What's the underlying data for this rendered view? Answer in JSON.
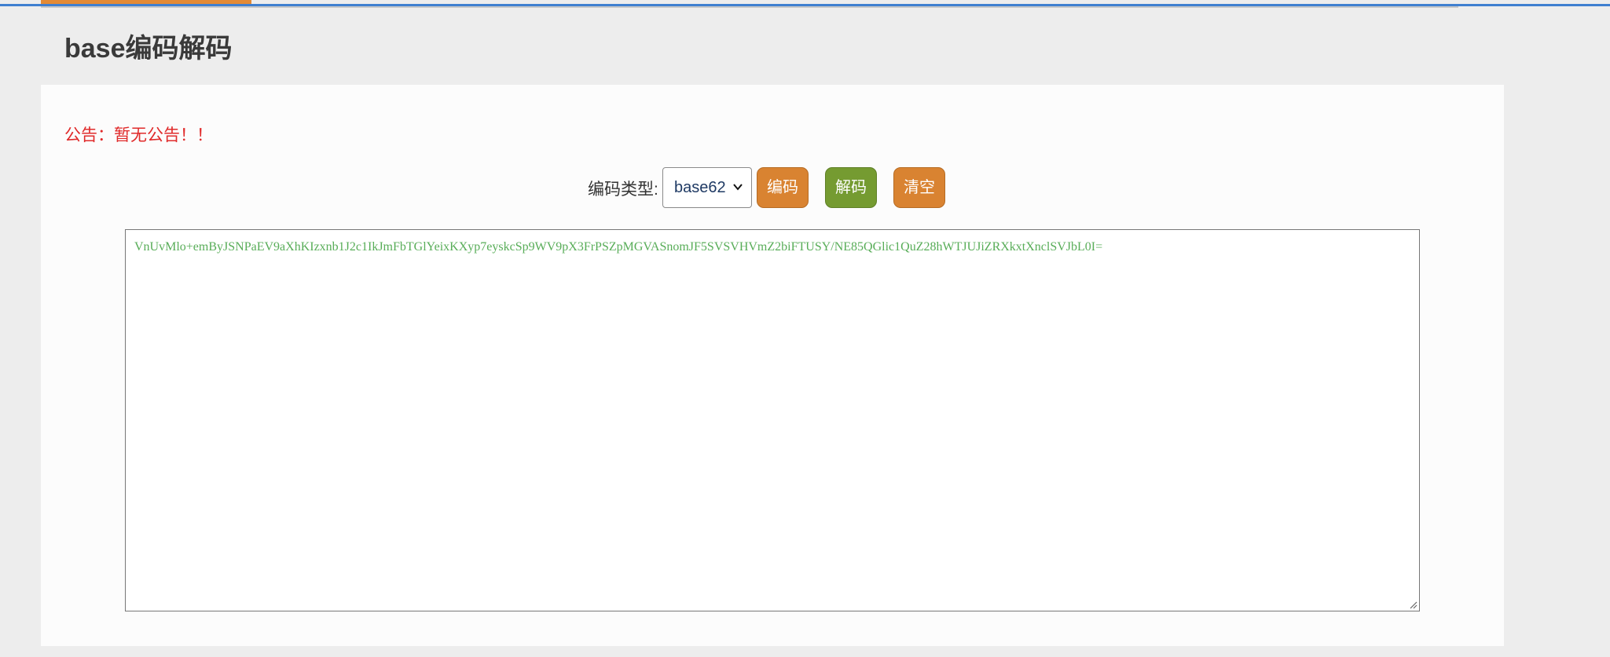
{
  "page": {
    "title": "base编码解码",
    "notice": "公告：暂无公告！！"
  },
  "controls": {
    "type_label": "编码类型:",
    "type_select": {
      "selected": "base62"
    },
    "encode_label": "编码",
    "decode_label": "解码",
    "clear_label": "清空"
  },
  "editor": {
    "content": "VnUvMlo+emByJSNPaEV9aXhKIzxnb1J2c1IkJmFbTGlYeixKXyp7eyskcSp9WV9pX3FrPSZpMGVASnomJF5SVSVHVmZ2biFTUSY/NE85QGlic1QuZ28hWTJUJiZRXkxtXnclSVJbL0I="
  },
  "colors": {
    "accent_orange": "#d98331",
    "accent_green": "#759b31",
    "notice_red": "#e02a2a",
    "content_green": "#58ad58",
    "top_rule_blue": "#3f7fd0"
  },
  "icons": {
    "select_arrow": "chevron-down-icon",
    "resize": "resize-grip-icon"
  }
}
